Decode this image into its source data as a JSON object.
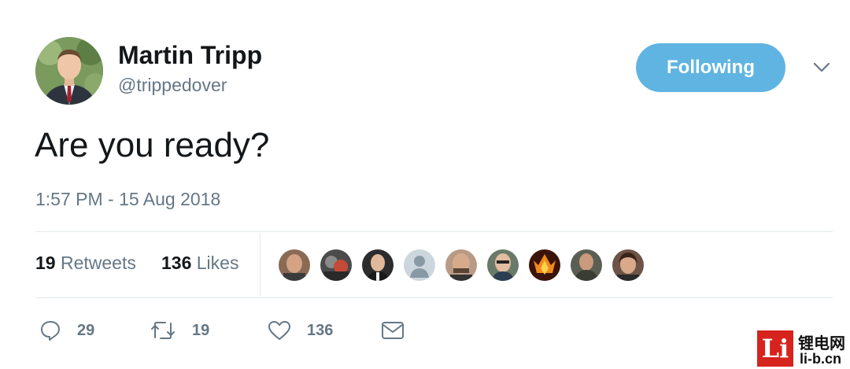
{
  "tweet": {
    "author": {
      "display_name": "Martin Tripp",
      "handle": "@trippedover"
    },
    "follow_button_label": "Following",
    "text": "Are you ready?",
    "timestamp": "1:57 PM - 15 Aug 2018",
    "stats": {
      "retweets_count": "19",
      "retweets_label": "Retweets",
      "likes_count": "136",
      "likes_label": "Likes"
    },
    "actions": {
      "replies": "29",
      "retweets": "19",
      "likes": "136"
    }
  },
  "watermark": {
    "logo": "Li",
    "name": "锂电网",
    "url": "li-b.cn"
  },
  "colors": {
    "follow_button": "#5fb4e2",
    "secondary_text": "#657786",
    "primary_text": "#14171a",
    "divider": "#e1e8ed",
    "watermark_red": "#d6231d"
  }
}
